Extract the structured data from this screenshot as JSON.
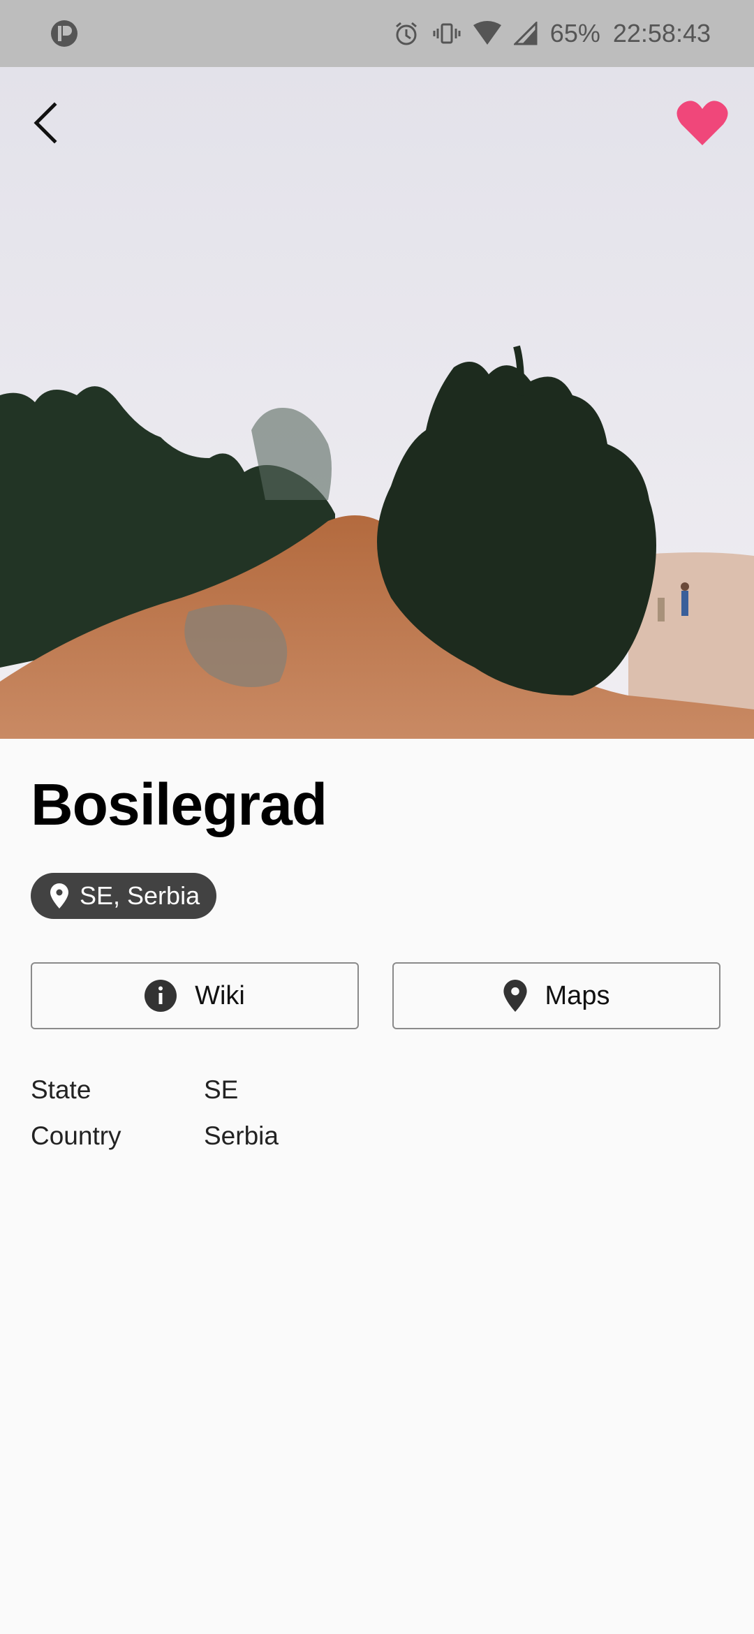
{
  "status_bar": {
    "battery": "65%",
    "time": "22:58:43",
    "icons": [
      "app-indicator-icon",
      "alarm-icon",
      "vibrate-icon",
      "wifi-icon",
      "signal-icon"
    ]
  },
  "hero": {
    "image": "foggy hillside with trees and hikers",
    "back_icon": "back-arrow-icon",
    "favorite_icon": "heart-icon",
    "favorite_color": "#f0477a"
  },
  "place": {
    "name": "Bosilegrad",
    "location_chip": "SE, Serbia"
  },
  "buttons": {
    "wiki_label": "Wiki",
    "maps_label": "Maps"
  },
  "details": [
    {
      "key": "State",
      "value": "SE"
    },
    {
      "key": "Country",
      "value": "Serbia"
    }
  ]
}
